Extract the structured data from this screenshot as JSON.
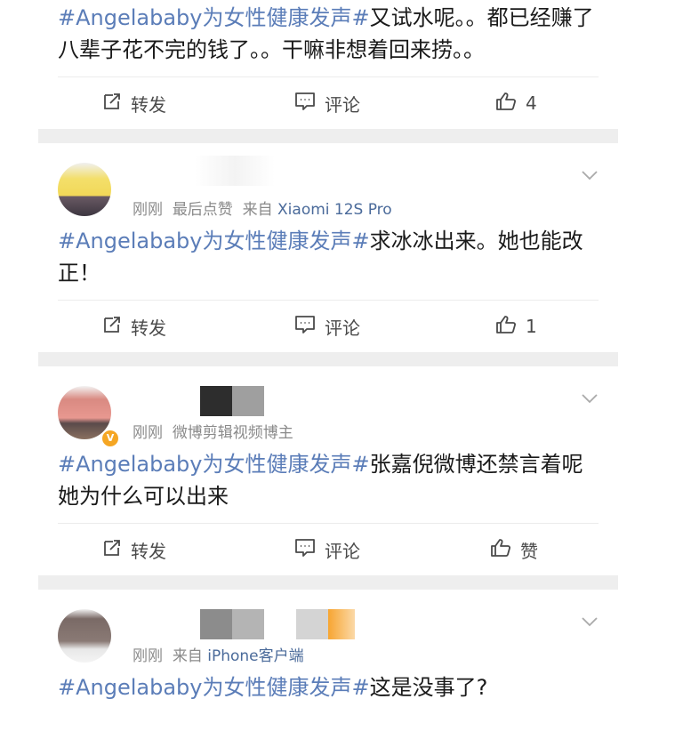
{
  "posts": [
    {
      "text_tag": "#Angelababy为女性健康发声#",
      "text_body": "又试水呢。。都已经赚了八辈子花不完的钱了。。干嘛非想着回来捞。。",
      "actions": {
        "repost": "转发",
        "comment": "评论",
        "like": "4"
      }
    },
    {
      "meta_time": "刚刚",
      "meta_extra": "最后点赞",
      "meta_from": "来自",
      "meta_device": "Xiaomi 12S Pro",
      "text_tag": "#Angelababy为女性健康发声#",
      "text_body": "求冰冰出来。她也能改正！",
      "actions": {
        "repost": "转发",
        "comment": "评论",
        "like": "1"
      }
    },
    {
      "meta_time": "刚刚",
      "meta_extra": "微博剪辑视频博主",
      "text_tag": "#Angelababy为女性健康发声#",
      "text_body": "张嘉倪微博还禁言着呢她为什么可以出来",
      "actions": {
        "repost": "转发",
        "comment": "评论",
        "like": "赞"
      }
    },
    {
      "meta_time": "刚刚",
      "meta_from": "来自",
      "meta_device": "iPhone客户端",
      "text_tag": "#Angelababy为女性健康发声#",
      "text_body": "这是没事了?"
    }
  ],
  "icons": [
    "repost-icon",
    "comment-icon",
    "like-icon",
    "chevron-down-icon",
    "verified-badge-icon"
  ],
  "colors": {
    "tag": "#5b7db8",
    "meta": "#8a8a8a",
    "device": "#4a6a9a",
    "separator": "#eeeeee",
    "badge": "#f5a623"
  }
}
